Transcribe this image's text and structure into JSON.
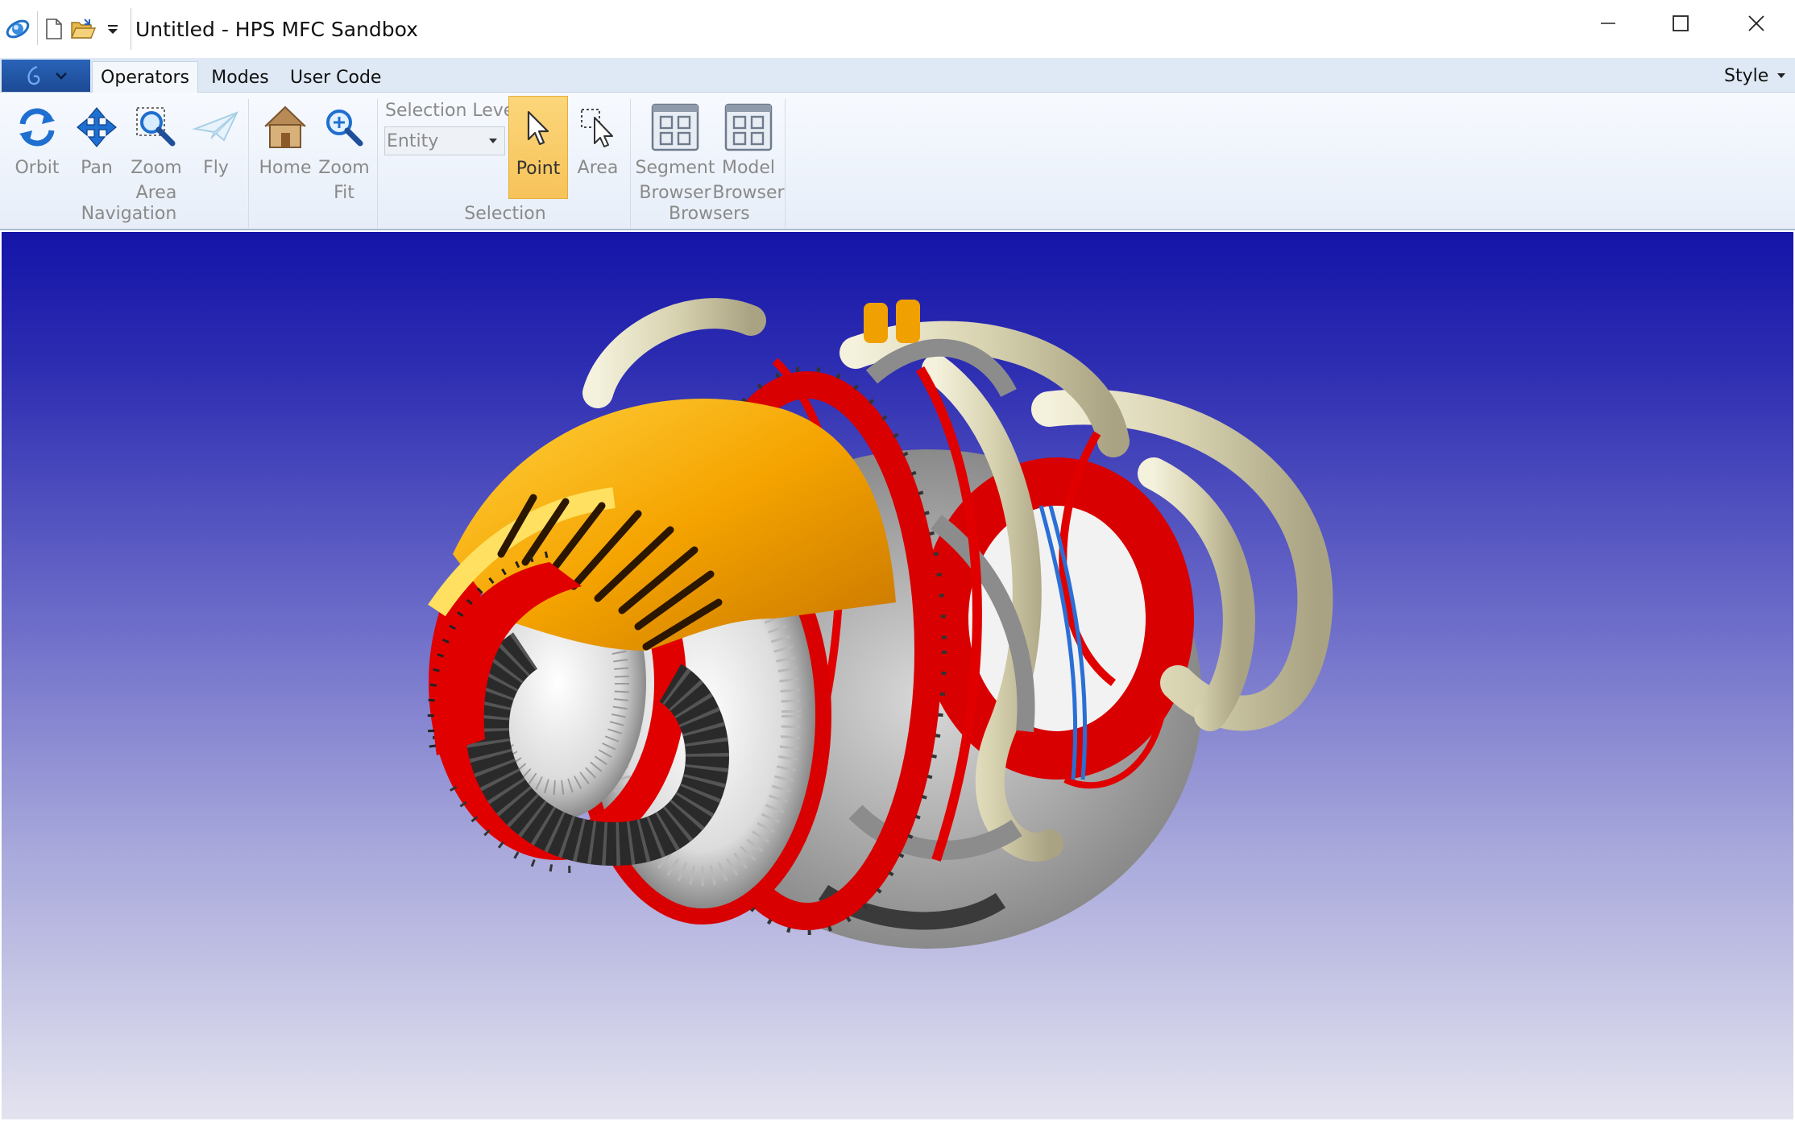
{
  "window": {
    "title": "Untitled - HPS MFC Sandbox"
  },
  "tabs": {
    "operators": "Operators",
    "modes": "Modes",
    "user_code": "User Code",
    "style": "Style"
  },
  "ribbon": {
    "navigation": {
      "label": "Navigation",
      "orbit": "Orbit",
      "pan": "Pan",
      "zoom_area_1": "Zoom",
      "zoom_area_2": "Area",
      "fly": "Fly"
    },
    "view": {
      "home": "Home",
      "zoom_fit_1": "Zoom",
      "zoom_fit_2": "Fit"
    },
    "selection": {
      "label": "Selection",
      "level_label": "Selection Level",
      "level_value": "Entity",
      "point": "Point",
      "area": "Area"
    },
    "browsers": {
      "label": "Browsers",
      "segment_1": "Segment",
      "segment_2": "Browser",
      "model_1": "Model",
      "model_2": "Browser"
    }
  },
  "viewport": {
    "model": "jet-engine-3d-model",
    "background_top": "#1414a8",
    "background_bottom": "#e3e3ef"
  },
  "colors": {
    "accent_blue": "#1c4a95",
    "selected_button": "#f7c35a",
    "engine_orange": "#f0a000",
    "engine_red": "#e00000"
  }
}
